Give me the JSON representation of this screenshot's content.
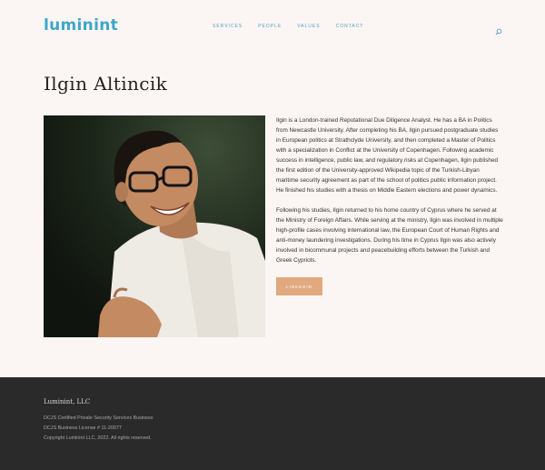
{
  "header": {
    "logo": "luminint",
    "nav": [
      "SERVICES",
      "PEOPLE",
      "VALUES",
      "CONTACT"
    ]
  },
  "profile": {
    "name": "Ilgin Altincik",
    "bio_paragraphs": [
      "Ilgin is a London-trained Reputational Due Diligence Analyst. He has a BA in Politics from Newcastle University. After completing his BA, Ilgin pursued postgraduate studies in European politics at Strathclyde University, and then completed a Master of Politics with a specialization in Conflict at the University of Copenhagen. Following academic success in intelligence, public law, and regulatory risks at Copenhagen, Ilgin published the first edition of the University-approved Wikipedia topic of the Turkish-Libyan maritime security agreement as part of the school of politics public information project.  He finished his studies with a thesis on Middle Eastern elections and power dynamics.",
      "Following his studies, Ilgin returned to his home country of Cyprus where he served at the Ministry of Foreign Affairs. While serving at the ministry, Ilgin was involved in multiple high-profile cases involving international law, the European Court of Human Rights and anti-money laundering investigations. During his time in Cyprus Ilgin was also actively involved in bicommunal projects and peacebuilding efforts between the Turkish and Greek Cypriots."
    ],
    "linkedin_label": "LINKEDIN"
  },
  "footer": {
    "title": "Luminint, LLC",
    "lines": [
      "DCJS Certified Private Security Services Business",
      "DCJS Business License # 11-20077",
      "Copyright Luminint LLC, 2022.  All rights reserved."
    ]
  },
  "colors": {
    "brand": "#3fa6c9",
    "button": "#e2a97f",
    "footer_bg": "#2a2a2a",
    "page_bg": "#fbf6f4"
  }
}
